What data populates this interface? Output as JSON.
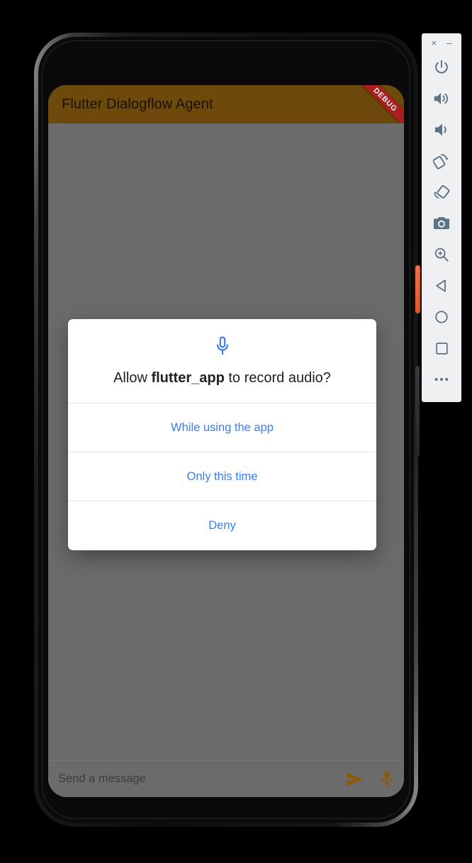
{
  "device": {
    "hardware": {
      "power_button": "power-button",
      "volume_rocker": "volume-rocker",
      "front_camera": "front-camera",
      "earpiece": "earpiece-speaker"
    }
  },
  "app": {
    "appbar": {
      "title": "Flutter Dialogflow Agent",
      "background_color": "#6D4A0B",
      "title_color": "#1C1203",
      "debug_ribbon": {
        "label": "DEBUG",
        "color": "#A81F1F",
        "text_color": "#F2F2F2"
      }
    },
    "body": {
      "background_color": "#6B6B6B"
    },
    "input_bar": {
      "placeholder": "Send a message",
      "value": "",
      "send_icon": "send-icon",
      "mic_icon": "microphone-icon",
      "icon_color": "#8A5A08"
    }
  },
  "permission_dialog": {
    "icon": "microphone-icon",
    "icon_color": "#3B7DEC",
    "title_prefix": "Allow ",
    "title_app_name": "flutter_app",
    "title_suffix": " to record audio?",
    "options": [
      {
        "label": "While using the app",
        "name": "while-using-the-app-button"
      },
      {
        "label": "Only this time",
        "name": "only-this-time-button"
      },
      {
        "label": "Deny",
        "name": "deny-button"
      }
    ],
    "option_color": "#3B7DEC",
    "background_color": "#FFFFFF"
  },
  "emulator_toolbar": {
    "background_color": "#EFF0F1",
    "icon_color": "#5B7384",
    "window_controls": [
      {
        "label": "×",
        "name": "close-window-button"
      },
      {
        "label": "–",
        "name": "minimize-window-button"
      }
    ],
    "buttons": [
      {
        "name": "power-icon",
        "title": "Power"
      },
      {
        "name": "volume-up-icon",
        "title": "Volume Up"
      },
      {
        "name": "volume-down-icon",
        "title": "Volume Down"
      },
      {
        "name": "rotate-left-icon",
        "title": "Rotate Left"
      },
      {
        "name": "rotate-right-icon",
        "title": "Rotate Right"
      },
      {
        "name": "camera-icon",
        "title": "Take Screenshot"
      },
      {
        "name": "zoom-in-icon",
        "title": "Enable Zoom"
      },
      {
        "name": "back-icon",
        "title": "Back"
      },
      {
        "name": "home-icon",
        "title": "Home"
      },
      {
        "name": "overview-icon",
        "title": "Overview"
      },
      {
        "name": "more-icon",
        "title": "More"
      }
    ]
  }
}
